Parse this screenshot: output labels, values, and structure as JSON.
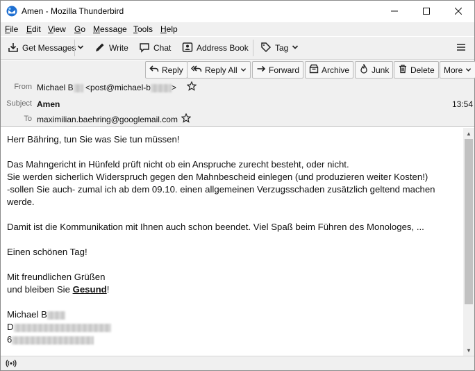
{
  "window": {
    "title": "Amen - Mozilla Thunderbird",
    "minimize_glyph": "—",
    "maximize_glyph": "☐",
    "close_glyph": "✕"
  },
  "menubar": {
    "items": [
      {
        "label_u": "F",
        "label_rest": "ile"
      },
      {
        "label_u": "E",
        "label_rest": "dit"
      },
      {
        "label_u": "V",
        "label_rest": "iew"
      },
      {
        "label_u": "G",
        "label_rest": "o"
      },
      {
        "label_u": "M",
        "label_rest": "essage"
      },
      {
        "label_u": "T",
        "label_rest": "ools"
      },
      {
        "label_u": "H",
        "label_rest": "elp"
      }
    ]
  },
  "toolbar": {
    "get_messages": "Get Messages",
    "write": "Write",
    "chat": "Chat",
    "address_book": "Address Book",
    "tag": "Tag",
    "menu_icon": "hamburger-icon"
  },
  "header_actions": {
    "reply": "Reply",
    "reply_all": "Reply All",
    "forward": "Forward",
    "archive": "Archive",
    "junk": "Junk",
    "delete": "Delete",
    "more": "More"
  },
  "headers": {
    "from_label": "From",
    "from_name": "Michael B",
    "from_email_prefix": "<post@michael-b",
    "from_email_suffix": ">",
    "subject_label": "Subject",
    "subject": "Amen",
    "time": "13:54",
    "to_label": "To",
    "to": "maximilian.baehring@googlemail.com"
  },
  "body": {
    "line1": "Herr Bähring, tun Sie was Sie tun müssen!",
    "line2": "Das Mahngericht in Hünfeld prüft nicht ob ein Anspruche zurecht besteht, oder nicht.",
    "line3": "Sie werden sicherlich Widerspruch gegen den Mahnbescheid einlegen (und produzieren weiter Kosten!)",
    "line4": "-sollen Sie auch- zumal ich ab dem 09.10. einen allgemeinen Verzugsschaden zusätzlich geltend machen",
    "line5": "werde.",
    "line6": "Damit ist die Kommunikation mit Ihnen auch schon beendet. Viel Spaß beim Führen des Monologes, ...",
    "line7": "Einen schönen Tag!",
    "line8": "Mit freundlichen Grüßen",
    "line9_pre": "und bleiben Sie ",
    "line9_bold": "Gesund",
    "line9_post": "!",
    "sig_name": "Michael B",
    "sig_line2_start": "D",
    "sig_line3_start": "6"
  },
  "colors": {
    "chrome_bg": "#f0f0f0",
    "thunderbird_blue": "#1f6fd1"
  }
}
